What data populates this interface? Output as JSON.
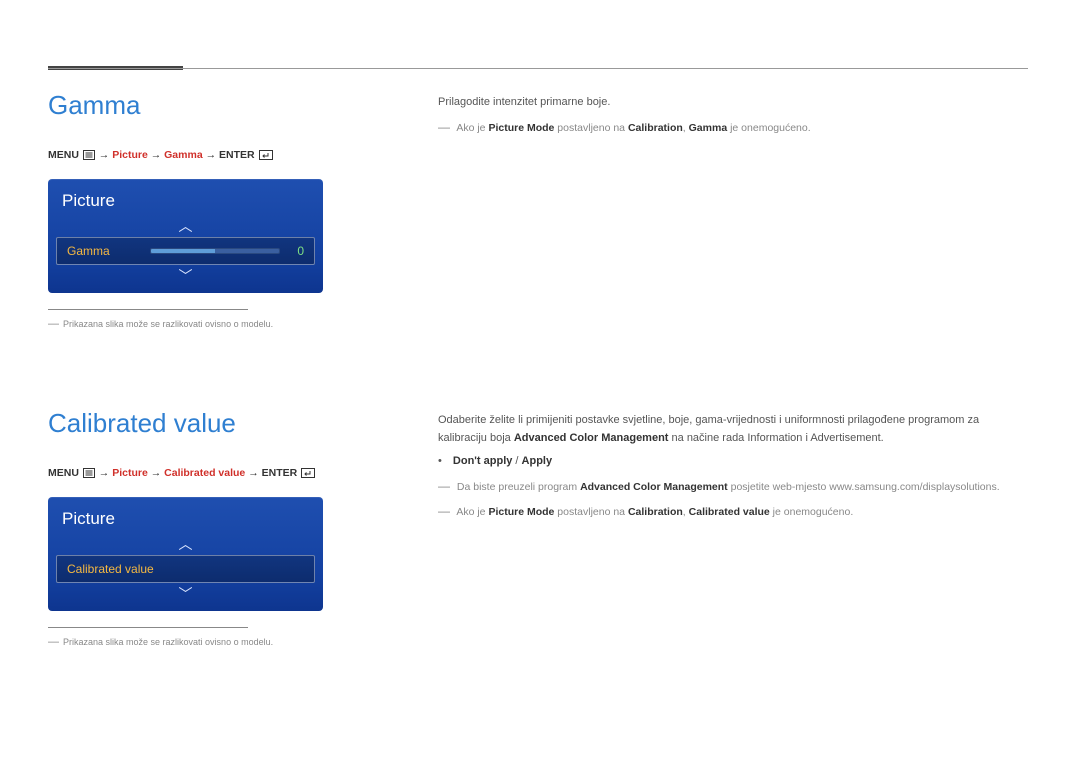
{
  "section1": {
    "title": "Gamma",
    "breadcrumb": {
      "pre": "MENU",
      "mid1": "Picture",
      "mid2": "Gamma",
      "last": "ENTER"
    },
    "osd": {
      "header": "Picture",
      "row_label": "Gamma",
      "row_value": "0"
    },
    "footnote": "Prikazana slika može se razlikovati ovisno o modelu.",
    "right_intro": "Prilagodite intenzitet primarne boje.",
    "right_note_pre": "Ako je ",
    "right_note_pm": "Picture Mode",
    "right_note_mid": " postavljeno na ",
    "right_note_cal": "Calibration",
    "right_note_sep": ", ",
    "right_note_g": "Gamma",
    "right_note_end": " je onemogućeno."
  },
  "section2": {
    "title": "Calibrated value",
    "breadcrumb": {
      "pre": "MENU",
      "mid1": "Picture",
      "mid2": "Calibrated value",
      "last": "ENTER"
    },
    "osd": {
      "header": "Picture",
      "row_label": "Calibrated value"
    },
    "footnote": "Prikazana slika može se razlikovati ovisno o modelu.",
    "right_p1a": "Odaberite želite li primijeniti postavke svjetline, boje, gama-vrijednosti i uniformnosti prilagođene programom za kalibraciju boja ",
    "right_p1b": "Advanced Color Management",
    "right_p1c": " na načine rada Information i Advertisement.",
    "options_a": "Don't apply",
    "options_sep": " / ",
    "options_b": "Apply",
    "note1_a": "Da biste preuzeli program ",
    "note1_b": "Advanced Color Management",
    "note1_c": " posjetite web-mjesto www.samsung.com/displaysolutions.",
    "note2_pre": "Ako je ",
    "note2_pm": "Picture Mode",
    "note2_mid": " postavljeno na ",
    "note2_cal": "Calibration",
    "note2_sep": ", ",
    "note2_cv": "Calibrated value",
    "note2_end": " je onemogućeno."
  }
}
